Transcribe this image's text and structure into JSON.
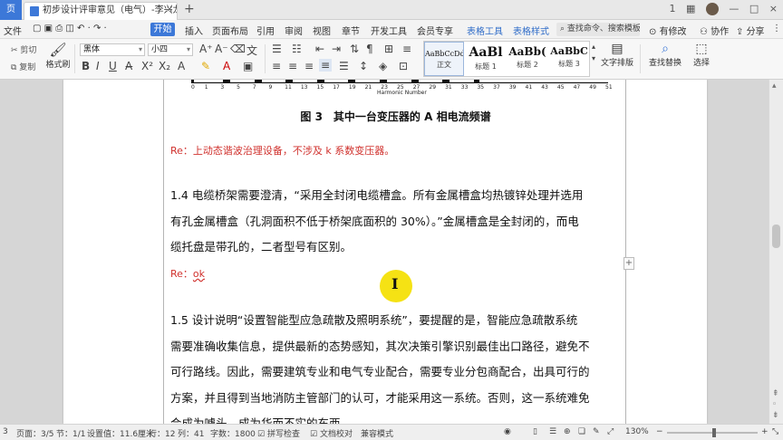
{
  "titlebar": {
    "home_tab": "页",
    "doc_tab": "初步设计评审意见（电气）-李兴龙",
    "close": "×",
    "add": "+",
    "ctrl_1": "1",
    "ctrl_min": "—",
    "ctrl_max": "□",
    "ctrl_close": "×"
  },
  "menubar": {
    "file": "文件",
    "start": "开始",
    "items": [
      "插入",
      "页面布局",
      "引用",
      "审阅",
      "视图",
      "章节",
      "开发工具",
      "会员专享"
    ],
    "ctx_tabs": [
      "表格工具",
      "表格样式"
    ],
    "search": "查找命令、搜索模板",
    "modify": "有修改",
    "collab": "协作",
    "share": "分享"
  },
  "ribbon": {
    "cut": "剪切",
    "copy": "复制",
    "format_painter": "格式刷",
    "font_name": "黑体",
    "font_size": "小四",
    "styles": [
      {
        "sample": "AaBbCcDd",
        "name": "正文"
      },
      {
        "sample": "AaBl",
        "name": "标题 1"
      },
      {
        "sample": "AaBb(",
        "name": "标题 2"
      },
      {
        "sample": "AaBbC",
        "name": "标题 3"
      }
    ],
    "text_layout": "文字排版",
    "find_replace": "查找替换",
    "select": "选择"
  },
  "document": {
    "axis_ticks": [
      "0",
      "1",
      "3",
      "5",
      "7",
      "9",
      "11",
      "13",
      "15",
      "17",
      "19",
      "21",
      "23",
      "25",
      "27",
      "29",
      "31",
      "33",
      "35",
      "37",
      "39",
      "41",
      "43",
      "45",
      "47",
      "49",
      "51"
    ],
    "axis_title": "Harmonic Number",
    "fig_caption": "图 3　其中一台变压器的 A 相电流频谱",
    "reply1": "Re：上动态谐波治理设备，不涉及 k 系数变压器。",
    "para_1_4": [
      "1.4 电缆桥架需要澄清，“采用全封闭电缆槽盒。所有金属槽盒均热镀锌处理并选用",
      "有孔金属槽盒（孔洞面积不低于桥架底面积的 30%）。”金属槽盒是全封闭的，而电",
      "缆托盘是带孔的，二者型号有区别。"
    ],
    "reply2_prefix": "Re：",
    "reply2_ok": "ok",
    "para_1_5": [
      "1.5 设计说明“设置智能型应急疏散及照明系统”，要提醒的是，智能应急疏散系统",
      "需要准确收集信息，提供最新的态势感知，其次决策引擎识别最佳出口路径，避免不",
      "可行路线。因此，需要建筑专业和电气专业配合，需要专业分包商配合，出具可行的",
      "方案，并且得到当地消防主管部门的认可，才能采用这一系统。否则，这一系统难免",
      "会成为噱头，成为华而不实的东西。"
    ]
  },
  "statusbar": {
    "page_num": "3",
    "page": "页面：3/5",
    "section": "节：1/1",
    "setting": "设置值：11.6厘米",
    "row": "行：12",
    "col": "列：41",
    "words": "字数：1800",
    "spell": "拼写检查",
    "doc_check": "文档校对",
    "compat": "兼容模式",
    "zoom": "130%"
  }
}
